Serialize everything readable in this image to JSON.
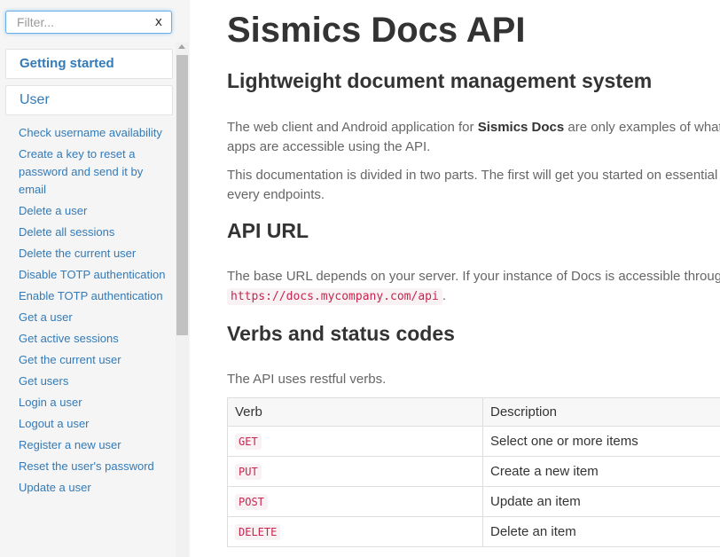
{
  "sidebar": {
    "filter": {
      "placeholder": "Filter...",
      "value": "",
      "clear_label": "x"
    },
    "groups": {
      "getting_started": "Getting started",
      "user": "User"
    },
    "endpoints": [
      "Check username availability",
      "Create a key to reset a password and send it by email",
      "Delete a user",
      "Delete all sessions",
      "Delete the current user",
      "Disable TOTP authentication",
      "Enable TOTP authentication",
      "Get a user",
      "Get active sessions",
      "Get the current user",
      "Get users",
      "Login a user",
      "Logout a user",
      "Register a new user",
      "Reset the user's password",
      "Update a user"
    ]
  },
  "main": {
    "title": "Sismics Docs API",
    "subtitle": "Lightweight document management system",
    "intro_1": {
      "before": "The web client and Android application for ",
      "bold": "Sismics Docs",
      "after": " are only examples of what i",
      "line2": "apps are accessible using the API."
    },
    "intro_2": {
      "line1": "This documentation is divided in two parts. The first will get you started on essential",
      "line2": "every endpoints."
    },
    "api_url_heading": "API URL",
    "api_url_text": "The base URL depends on your server. If your instance of Docs is accessible through",
    "api_url_code": "https://docs.mycompany.com/api",
    "api_url_suffix": ".",
    "verbs_heading": "Verbs and status codes",
    "verbs_text": "The API uses restful verbs.",
    "verbs_table": {
      "headers": [
        "Verb",
        "Description"
      ],
      "rows": [
        {
          "verb": "GET",
          "description": "Select one or more items"
        },
        {
          "verb": "PUT",
          "description": "Create a new item"
        },
        {
          "verb": "POST",
          "description": "Update an item"
        },
        {
          "verb": "DELETE",
          "description": "Delete an item"
        }
      ]
    }
  }
}
